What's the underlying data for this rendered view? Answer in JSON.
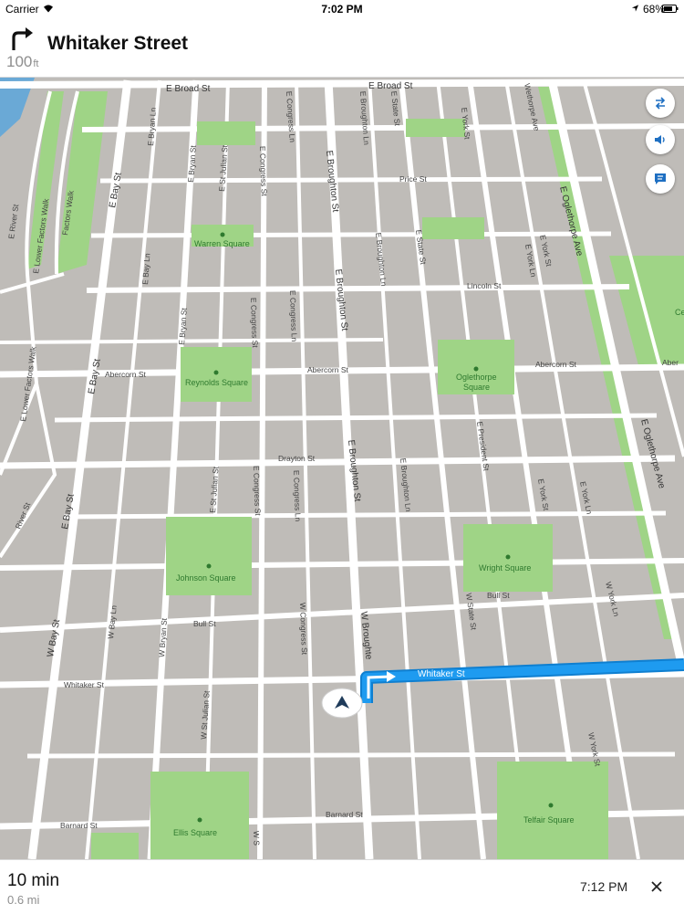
{
  "status_bar": {
    "carrier": "Carrier",
    "time": "7:02 PM",
    "battery_percent": "68%",
    "icons": [
      "wifi-icon",
      "location-arrow-icon",
      "battery-icon"
    ]
  },
  "navigation": {
    "turn_icon": "turn-right-icon",
    "distance_value": "100",
    "distance_unit": "ft",
    "street": "Whitaker Street"
  },
  "map": {
    "streets": {
      "broad_1": "E Broad St",
      "broad_2": "E Broad St",
      "oglethorpe_top": "Wethorpe Ave",
      "congress_a": "E Congress Ln",
      "broughton_ln_top": "E Broughton Ln",
      "state_top": "E State St",
      "york_top": "E York St",
      "bryan_ln_top": "E Bryan Ln",
      "bryan_top": "E Bryan St",
      "julian_top": "E St Julian St",
      "congress_top": "E Congress St",
      "river": "E River St",
      "lower_factors_1": "E Lower Factors Walk",
      "factors_walk": "Factors Walk",
      "bay_top": "E Bay St",
      "price": "Price St",
      "broughton_top": "E Broughton St",
      "oglethorpe_1": "E Oglethorpe Ave",
      "broughton_ln_mid": "E Broughton Ln",
      "state_mid": "E State St",
      "york_ln_a": "E York Ln",
      "york_mid": "E York St",
      "bay_ln": "E Bay Ln",
      "lincoln": "Lincoln St",
      "bryan_mid": "E Bryan St",
      "congress_mid": "E Congress St",
      "congress_ln_mid": "E Congress Ln",
      "broughton_mid": "E Broughton St",
      "bay_mid": "E Bay St",
      "lower_factors_2": "E Lower Factors Walk",
      "abercorn_1": "Abercorn St",
      "abercorn_2": "Abercorn St",
      "abercorn_3": "Abercorn St",
      "abercorn_4": "Aber",
      "drayton": "Drayton St",
      "julian_mid": "E St Julian St",
      "congress_low": "E Congress St",
      "congress_ln_low": "E Congress Ln",
      "broughton_low": "E Broughton St",
      "broughton_ln_low": "E Broughton Ln",
      "president": "E President St",
      "york_low": "E York St",
      "york_ln_b": "E York Ln",
      "oglethorpe_2": "E Oglethorpe Ave",
      "river_low": "River St",
      "bay_low": "E Bay St",
      "w_bay": "W Bay St",
      "w_bay_ln": "W Bay Ln",
      "w_bryan": "W Bryan St",
      "bull_1": "Bull St",
      "bull_2": "Bull St",
      "w_congress": "W Congress St",
      "w_broughton": "W Broughte",
      "w_state": "W State St",
      "w_york_ln": "W York Ln",
      "w_york": "W York St",
      "whitaker_1": "Whitaker St",
      "whitaker_route": "Whitaker St",
      "w_julian": "W St Julian St",
      "barnard_1": "Barnard St",
      "barnard_2": "Barnard St",
      "w_partial": "W S"
    },
    "parks": {
      "warren": "Warren Square",
      "reynolds": "Reynolds Square",
      "oglethorpe_1": "Oglethorpe",
      "oglethorpe_2": "Square",
      "johnson": "Johnson Square",
      "wright": "Wright Square",
      "ellis": "Ellis Square",
      "telfair": "Telfair Square",
      "partial_right": "Ce"
    },
    "colors": {
      "route": "#1e9bf0",
      "park": "#9fd486",
      "road": "#ffffff",
      "block": "#bdbab6"
    },
    "controls": [
      "swap-routes-icon",
      "sound-icon",
      "chat-icon"
    ],
    "position_marker": "navigation-arrow-icon"
  },
  "trip": {
    "duration": "10 min",
    "distance": "0.6 mi",
    "arrival": "7:12 PM",
    "close_icon": "close-icon"
  }
}
